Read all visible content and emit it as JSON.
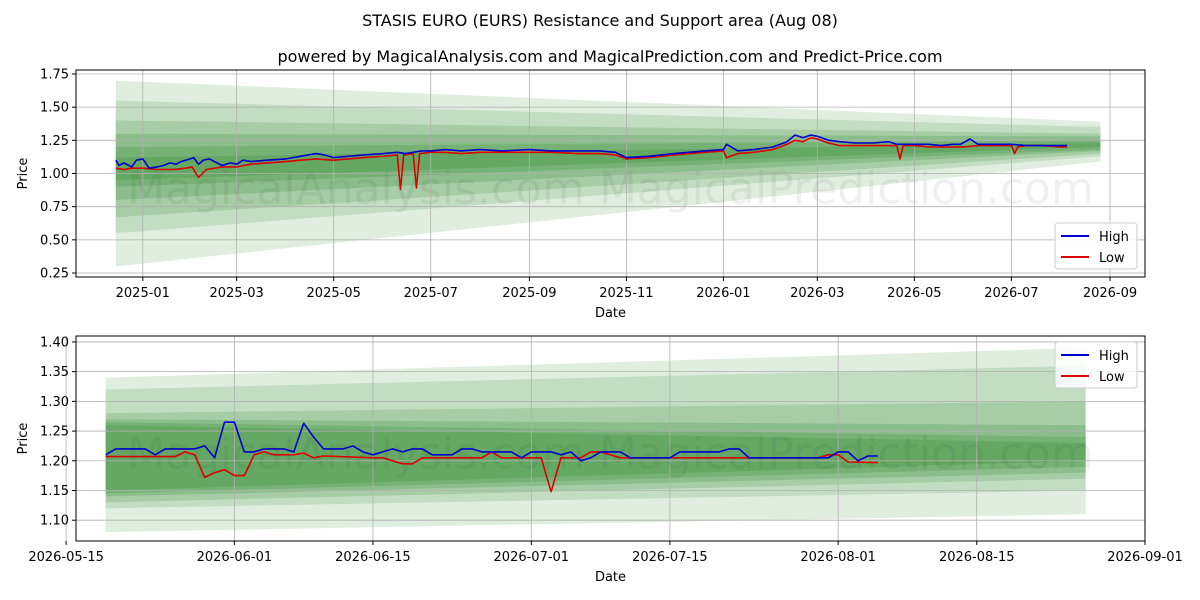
{
  "title": "STASIS EURO (EURS) Resistance and Support area (Aug 08)",
  "subtitle": "powered by MagicalAnalysis.com and MagicalPrediction.com and Predict-Price.com",
  "watermark": "MagicalAnalysis.com    MagicalPrediction.com",
  "colors": {
    "high": "#0000cc",
    "low": "#dd0000",
    "band": "#2e8b2e",
    "grid": "#b0b0b0"
  },
  "chart_data": [
    {
      "type": "line",
      "xlabel": "Date",
      "ylabel": "Price",
      "xlim": [
        "2024-11-20",
        "2026-09-23"
      ],
      "ylim": [
        0.22,
        1.78
      ],
      "grid": true,
      "legend_position": "lower-right",
      "x_ticks": [
        "2025-01",
        "2025-03",
        "2025-05",
        "2025-07",
        "2025-09",
        "2025-11",
        "2026-01",
        "2026-03",
        "2026-05",
        "2026-07",
        "2026-09"
      ],
      "x_tick_dates": [
        "2025-01-01",
        "2025-03-01",
        "2025-05-01",
        "2025-07-01",
        "2025-09-01",
        "2025-11-01",
        "2026-01-01",
        "2026-03-01",
        "2026-05-01",
        "2026-07-01",
        "2026-09-01"
      ],
      "y_ticks": [
        "0.25",
        "0.50",
        "0.75",
        "1.00",
        "1.25",
        "1.50",
        "1.75"
      ],
      "y_tick_values": [
        0.25,
        0.5,
        0.75,
        1.0,
        1.25,
        1.5,
        1.75
      ],
      "band_x": [
        "2024-12-15",
        "2026-08-26"
      ],
      "bands": [
        {
          "upper": [
            1.7,
            1.39
          ],
          "lower": [
            0.3,
            1.09
          ]
        },
        {
          "upper": [
            1.55,
            1.35
          ],
          "lower": [
            0.55,
            1.13
          ]
        },
        {
          "upper": [
            1.4,
            1.3
          ],
          "lower": [
            0.67,
            1.15
          ]
        },
        {
          "upper": [
            1.3,
            1.28
          ],
          "lower": [
            0.8,
            1.17
          ]
        },
        {
          "upper": [
            1.2,
            1.25
          ],
          "lower": [
            0.9,
            1.18
          ]
        },
        {
          "upper": [
            1.12,
            1.23
          ],
          "lower": [
            0.95,
            1.2
          ]
        }
      ],
      "series": [
        {
          "name": "High",
          "x": [
            "2024-12-15",
            "2024-12-17",
            "2024-12-20",
            "2024-12-25",
            "2024-12-28",
            "2025-01-01",
            "2025-01-05",
            "2025-01-10",
            "2025-01-14",
            "2025-01-18",
            "2025-01-22",
            "2025-01-25",
            "2025-01-28",
            "2025-02-02",
            "2025-02-05",
            "2025-02-08",
            "2025-02-12",
            "2025-02-15",
            "2025-02-20",
            "2025-02-25",
            "2025-03-01",
            "2025-03-05",
            "2025-03-10",
            "2025-03-20",
            "2025-04-01",
            "2025-04-10",
            "2025-04-20",
            "2025-04-25",
            "2025-05-01",
            "2025-05-10",
            "2025-05-20",
            "2025-06-01",
            "2025-06-10",
            "2025-06-15",
            "2025-06-20",
            "2025-06-25",
            "2025-07-01",
            "2025-07-10",
            "2025-07-20",
            "2025-08-01",
            "2025-08-15",
            "2025-09-01",
            "2025-09-15",
            "2025-10-01",
            "2025-10-15",
            "2025-10-25",
            "2025-11-01",
            "2025-11-15",
            "2025-12-01",
            "2025-12-20",
            "2026-01-01",
            "2026-01-03",
            "2026-01-10",
            "2026-01-20",
            "2026-02-01",
            "2026-02-10",
            "2026-02-15",
            "2026-02-20",
            "2026-02-25",
            "2026-03-01",
            "2026-03-08",
            "2026-03-15",
            "2026-03-25",
            "2026-04-05",
            "2026-04-15",
            "2026-04-20",
            "2026-05-01",
            "2026-05-10",
            "2026-05-18",
            "2026-05-25",
            "2026-05-30",
            "2026-06-05",
            "2026-06-10",
            "2026-06-20",
            "2026-07-01",
            "2026-07-10",
            "2026-07-20",
            "2026-08-01",
            "2026-08-05"
          ],
          "values": [
            1.1,
            1.06,
            1.08,
            1.05,
            1.1,
            1.11,
            1.04,
            1.05,
            1.06,
            1.08,
            1.07,
            1.09,
            1.1,
            1.12,
            1.07,
            1.1,
            1.11,
            1.09,
            1.06,
            1.08,
            1.07,
            1.1,
            1.09,
            1.1,
            1.11,
            1.13,
            1.15,
            1.14,
            1.12,
            1.13,
            1.14,
            1.15,
            1.16,
            1.15,
            1.16,
            1.17,
            1.17,
            1.18,
            1.17,
            1.18,
            1.17,
            1.18,
            1.17,
            1.17,
            1.17,
            1.16,
            1.12,
            1.13,
            1.15,
            1.17,
            1.18,
            1.22,
            1.17,
            1.18,
            1.2,
            1.24,
            1.29,
            1.27,
            1.29,
            1.28,
            1.25,
            1.24,
            1.23,
            1.23,
            1.24,
            1.22,
            1.22,
            1.22,
            1.21,
            1.22,
            1.22,
            1.26,
            1.22,
            1.22,
            1.22,
            1.21,
            1.21,
            1.21,
            1.21
          ]
        },
        {
          "name": "Low",
          "x": [
            "2024-12-15",
            "2024-12-20",
            "2024-12-25",
            "2025-01-01",
            "2025-01-10",
            "2025-01-20",
            "2025-01-28",
            "2025-02-01",
            "2025-02-05",
            "2025-02-10",
            "2025-02-20",
            "2025-03-01",
            "2025-03-10",
            "2025-03-20",
            "2025-04-01",
            "2025-04-10",
            "2025-04-20",
            "2025-05-01",
            "2025-05-10",
            "2025-05-20",
            "2025-06-01",
            "2025-06-10",
            "2025-06-12",
            "2025-06-14",
            "2025-06-20",
            "2025-06-22",
            "2025-06-24",
            "2025-07-01",
            "2025-07-10",
            "2025-07-20",
            "2025-08-01",
            "2025-08-15",
            "2025-09-01",
            "2025-09-15",
            "2025-10-01",
            "2025-10-15",
            "2025-10-25",
            "2025-11-01",
            "2025-11-15",
            "2025-12-01",
            "2025-12-20",
            "2026-01-01",
            "2026-01-03",
            "2026-01-10",
            "2026-01-20",
            "2026-02-01",
            "2026-02-10",
            "2026-02-15",
            "2026-02-20",
            "2026-02-25",
            "2026-03-01",
            "2026-03-08",
            "2026-03-15",
            "2026-03-25",
            "2026-04-05",
            "2026-04-15",
            "2026-04-20",
            "2026-04-22",
            "2026-04-24",
            "2026-05-01",
            "2026-05-10",
            "2026-05-18",
            "2026-05-25",
            "2026-06-01",
            "2026-06-10",
            "2026-06-20",
            "2026-07-01",
            "2026-07-03",
            "2026-07-05",
            "2026-07-10",
            "2026-07-20",
            "2026-08-01",
            "2026-08-05"
          ],
          "values": [
            1.04,
            1.03,
            1.04,
            1.04,
            1.03,
            1.03,
            1.04,
            1.05,
            0.97,
            1.03,
            1.05,
            1.05,
            1.07,
            1.08,
            1.09,
            1.1,
            1.11,
            1.1,
            1.11,
            1.12,
            1.13,
            1.14,
            0.88,
            1.14,
            1.15,
            0.89,
            1.15,
            1.16,
            1.16,
            1.15,
            1.16,
            1.16,
            1.16,
            1.16,
            1.15,
            1.15,
            1.14,
            1.11,
            1.12,
            1.14,
            1.16,
            1.17,
            1.12,
            1.15,
            1.16,
            1.18,
            1.22,
            1.25,
            1.24,
            1.27,
            1.26,
            1.23,
            1.21,
            1.21,
            1.21,
            1.21,
            1.21,
            1.11,
            1.21,
            1.21,
            1.2,
            1.2,
            1.2,
            1.2,
            1.21,
            1.21,
            1.21,
            1.15,
            1.2,
            1.21,
            1.21,
            1.2,
            1.2
          ]
        }
      ]
    },
    {
      "type": "line",
      "xlabel": "Date",
      "ylabel": "Price",
      "xlim": [
        "2026-05-16",
        "2026-09-01"
      ],
      "ylim": [
        1.065,
        1.41
      ],
      "grid": true,
      "legend_position": "upper-right",
      "x_ticks": [
        "2026-05-15",
        "2026-06-01",
        "2026-06-15",
        "2026-07-01",
        "2026-07-15",
        "2026-08-01",
        "2026-08-15",
        "2026-09-01"
      ],
      "x_tick_dates": [
        "2026-05-15",
        "2026-06-01",
        "2026-06-15",
        "2026-07-01",
        "2026-07-15",
        "2026-08-01",
        "2026-08-15",
        "2026-09-01"
      ],
      "y_ticks": [
        "1.10",
        "1.15",
        "1.20",
        "1.25",
        "1.30",
        "1.35",
        "1.40"
      ],
      "y_tick_values": [
        1.1,
        1.15,
        1.2,
        1.25,
        1.3,
        1.35,
        1.4
      ],
      "band_x": [
        "2026-05-19",
        "2026-08-26"
      ],
      "bands": [
        {
          "upper": [
            1.34,
            1.39
          ],
          "lower": [
            1.08,
            1.11
          ]
        },
        {
          "upper": [
            1.32,
            1.36
          ],
          "lower": [
            1.12,
            1.15
          ]
        },
        {
          "upper": [
            1.28,
            1.3
          ],
          "lower": [
            1.13,
            1.17
          ]
        },
        {
          "upper": [
            1.27,
            1.26
          ],
          "lower": [
            1.14,
            1.18
          ]
        },
        {
          "upper": [
            1.265,
            1.24
          ],
          "lower": [
            1.145,
            1.19
          ]
        },
        {
          "upper": [
            1.26,
            1.23
          ],
          "lower": [
            1.15,
            1.2
          ]
        }
      ],
      "series": [
        {
          "name": "High",
          "x": [
            "2026-05-19",
            "2026-05-20",
            "2026-05-23",
            "2026-05-24",
            "2026-05-25",
            "2026-05-26",
            "2026-05-27",
            "2026-05-28",
            "2026-05-29",
            "2026-05-30",
            "2026-05-31",
            "2026-06-01",
            "2026-06-02",
            "2026-06-03",
            "2026-06-04",
            "2026-06-05",
            "2026-06-06",
            "2026-06-07",
            "2026-06-08",
            "2026-06-09",
            "2026-06-10",
            "2026-06-11",
            "2026-06-12",
            "2026-06-13",
            "2026-06-14",
            "2026-06-15",
            "2026-06-16",
            "2026-06-17",
            "2026-06-18",
            "2026-06-19",
            "2026-06-20",
            "2026-06-21",
            "2026-06-22",
            "2026-06-23",
            "2026-06-24",
            "2026-06-25",
            "2026-06-26",
            "2026-06-27",
            "2026-06-28",
            "2026-06-29",
            "2026-06-30",
            "2026-07-01",
            "2026-07-02",
            "2026-07-03",
            "2026-07-04",
            "2026-07-05",
            "2026-07-06",
            "2026-07-07",
            "2026-07-08",
            "2026-07-09",
            "2026-07-10",
            "2026-07-11",
            "2026-07-14",
            "2026-07-15",
            "2026-07-16",
            "2026-07-19",
            "2026-07-20",
            "2026-07-21",
            "2026-07-22",
            "2026-07-23",
            "2026-07-30",
            "2026-07-31",
            "2026-08-01",
            "2026-08-02",
            "2026-08-03",
            "2026-08-04",
            "2026-08-05"
          ],
          "values": [
            1.21,
            1.22,
            1.22,
            1.21,
            1.22,
            1.22,
            1.22,
            1.22,
            1.225,
            1.205,
            1.265,
            1.265,
            1.215,
            1.215,
            1.22,
            1.22,
            1.22,
            1.215,
            1.263,
            1.24,
            1.22,
            1.22,
            1.22,
            1.225,
            1.215,
            1.21,
            1.215,
            1.22,
            1.215,
            1.22,
            1.22,
            1.21,
            1.21,
            1.21,
            1.22,
            1.22,
            1.215,
            1.215,
            1.215,
            1.215,
            1.205,
            1.215,
            1.215,
            1.215,
            1.21,
            1.215,
            1.2,
            1.205,
            1.215,
            1.215,
            1.215,
            1.205,
            1.205,
            1.205,
            1.215,
            1.215,
            1.215,
            1.22,
            1.22,
            1.205,
            1.205,
            1.205,
            1.215,
            1.215,
            1.2,
            1.208,
            1.208
          ]
        },
        {
          "name": "Low",
          "x": [
            "2026-05-19",
            "2026-05-20",
            "2026-05-26",
            "2026-05-27",
            "2026-05-28",
            "2026-05-29",
            "2026-05-30",
            "2026-05-31",
            "2026-06-01",
            "2026-06-02",
            "2026-06-03",
            "2026-06-04",
            "2026-06-05",
            "2026-06-06",
            "2026-06-07",
            "2026-06-08",
            "2026-06-09",
            "2026-06-10",
            "2026-06-15",
            "2026-06-16",
            "2026-06-17",
            "2026-06-18",
            "2026-06-19",
            "2026-06-20",
            "2026-06-25",
            "2026-06-26",
            "2026-06-27",
            "2026-06-28",
            "2026-06-29",
            "2026-07-01",
            "2026-07-02",
            "2026-07-03",
            "2026-07-04",
            "2026-07-06",
            "2026-07-07",
            "2026-07-08",
            "2026-07-09",
            "2026-07-10",
            "2026-07-15",
            "2026-07-20",
            "2026-07-21",
            "2026-07-30",
            "2026-07-31",
            "2026-08-01",
            "2026-08-02",
            "2026-08-05"
          ],
          "values": [
            1.207,
            1.207,
            1.207,
            1.215,
            1.21,
            1.172,
            1.18,
            1.185,
            1.175,
            1.175,
            1.21,
            1.215,
            1.21,
            1.21,
            1.21,
            1.213,
            1.205,
            1.208,
            1.205,
            1.205,
            1.2,
            1.195,
            1.195,
            1.205,
            1.205,
            1.205,
            1.215,
            1.205,
            1.205,
            1.205,
            1.205,
            1.148,
            1.205,
            1.205,
            1.215,
            1.215,
            1.21,
            1.205,
            1.205,
            1.205,
            1.205,
            1.205,
            1.21,
            1.21,
            1.198,
            1.197
          ]
        }
      ]
    }
  ]
}
